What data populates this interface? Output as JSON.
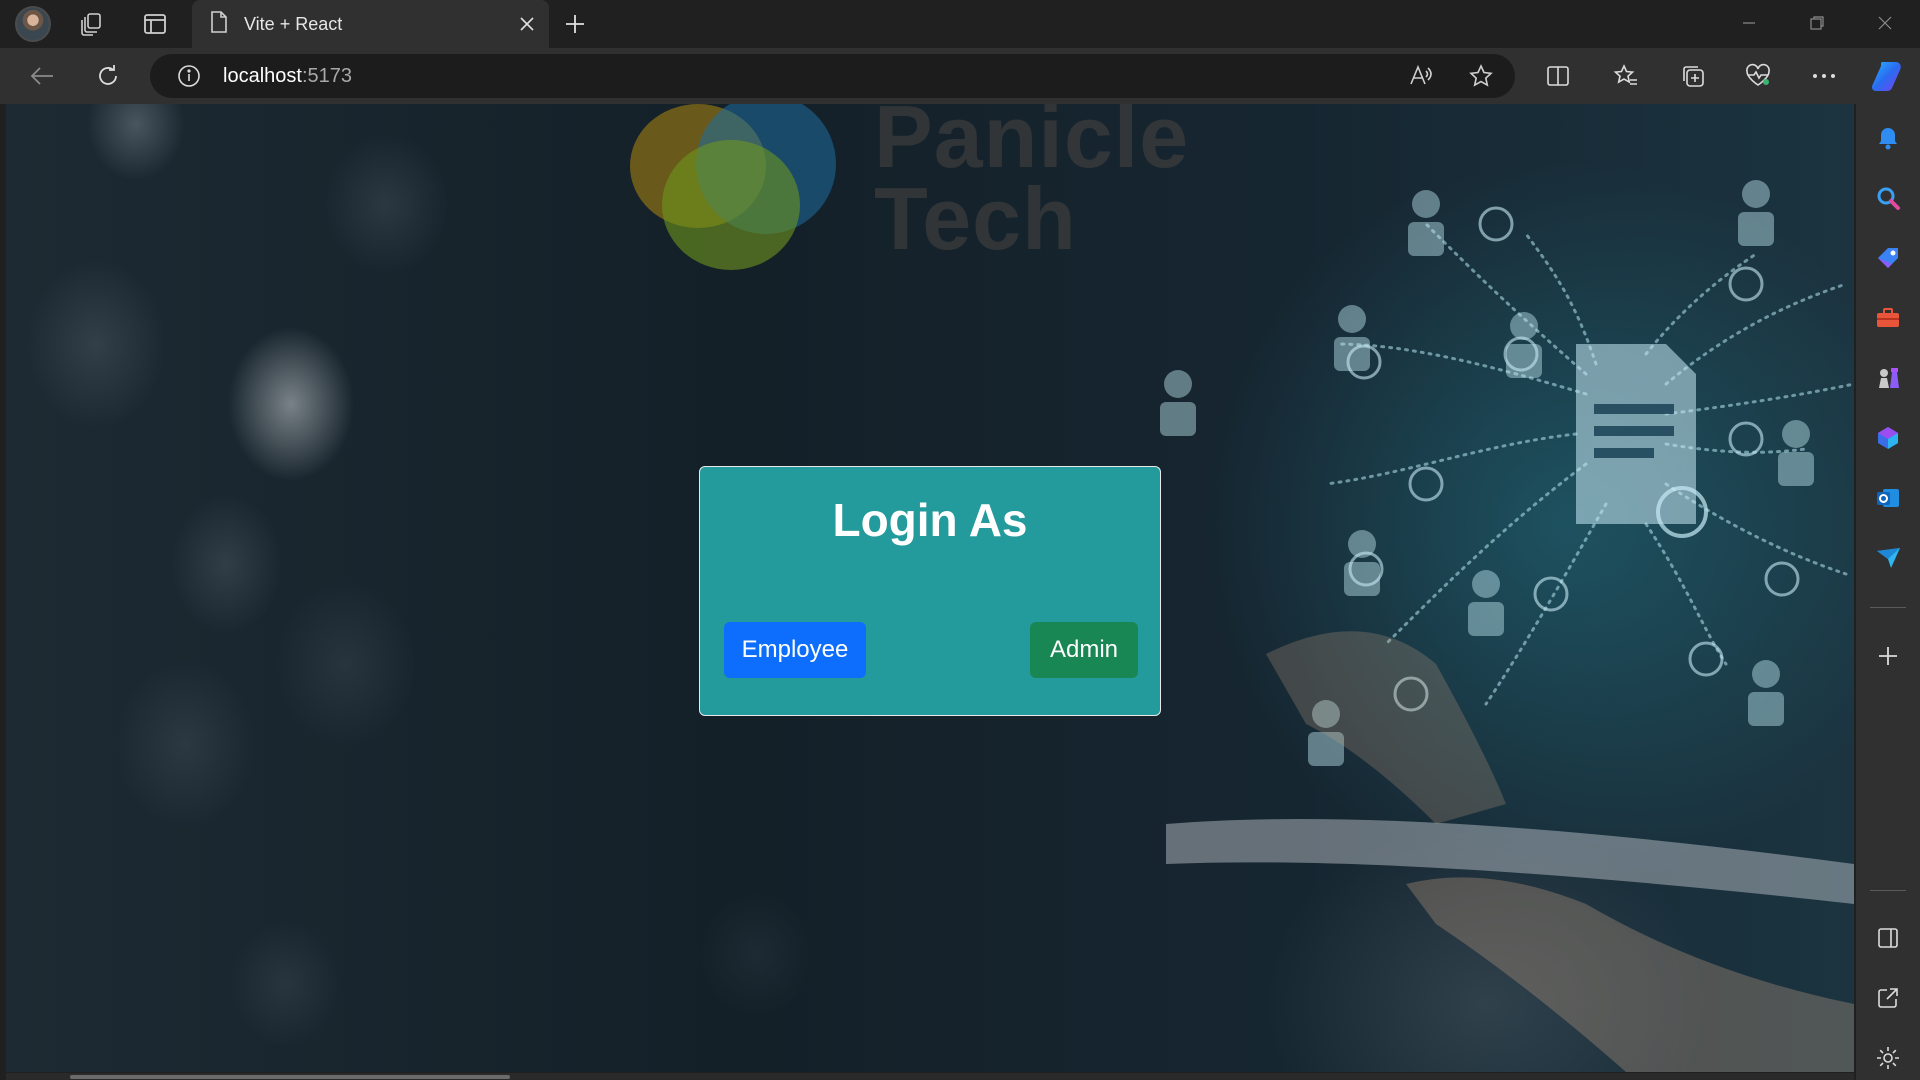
{
  "browser": {
    "tab": {
      "title": "Vite + React"
    },
    "address": {
      "host": "localhost",
      "port": ":5173"
    }
  },
  "page": {
    "background_brand": {
      "line1": "Panicle",
      "line2": "Tech"
    },
    "login_card": {
      "title": "Login As",
      "employee_button": "Employee",
      "admin_button": "Admin"
    }
  },
  "colors": {
    "card_bg": "#239a9b",
    "employee_btn": "#0d6efd",
    "admin_btn": "#198754"
  },
  "sidebar": {
    "items": [
      "bell-icon",
      "search-icon",
      "tag-icon",
      "toolbox-icon",
      "chess-icon",
      "copilot-icon",
      "outlook-icon",
      "send-icon",
      "add-icon",
      "split-panel-icon",
      "external-link-icon",
      "settings-icon"
    ]
  }
}
